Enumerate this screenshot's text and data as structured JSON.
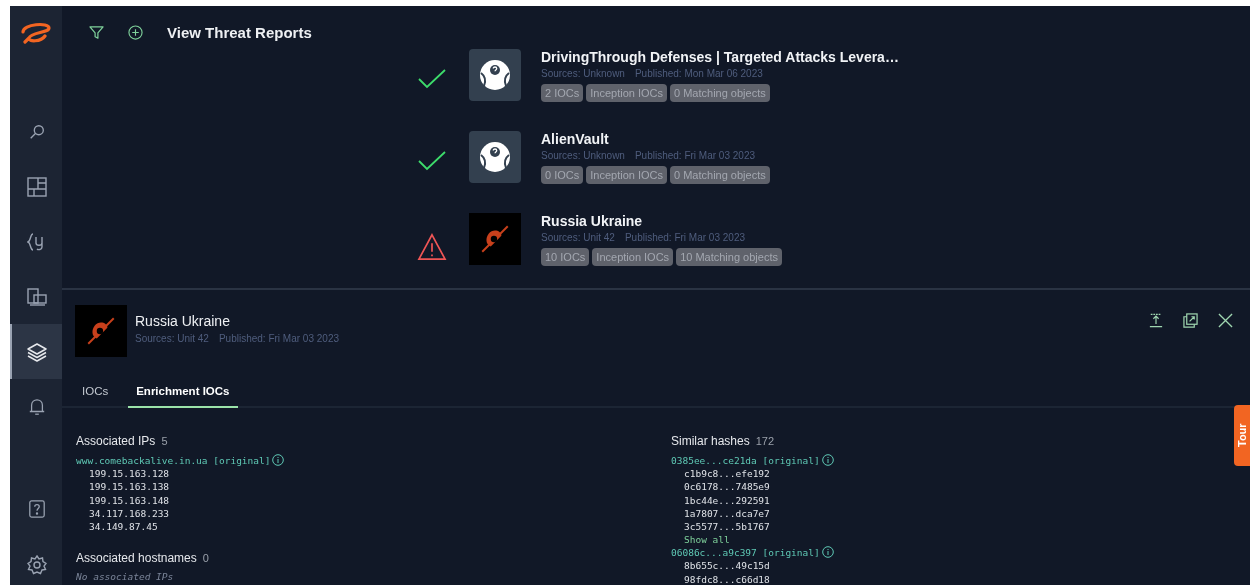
{
  "sidebar": {
    "items": [
      {
        "kind": "search",
        "selected": false
      },
      {
        "kind": "dashboard",
        "selected": false
      },
      {
        "kind": "code",
        "selected": false
      },
      {
        "kind": "monitor",
        "selected": false
      },
      {
        "kind": "layers",
        "selected": true
      },
      {
        "kind": "bell",
        "selected": false
      }
    ],
    "bottom": [
      {
        "kind": "help"
      },
      {
        "kind": "settings"
      }
    ]
  },
  "toolbar": {
    "title": "View Threat Reports"
  },
  "reports": [
    {
      "kind": "ok",
      "thumb": {
        "kind": "unknown"
      },
      "title": "DrivingThrough Defenses | Targeted Attacks Levera…",
      "sources": "Sources: Unknown",
      "published": "Published: Mon Mar 06 2023",
      "tags": [
        "2 IOCs",
        "Inception IOCs",
        "0 Matching objects"
      ]
    },
    {
      "kind": "ok",
      "thumb": {
        "kind": "unknown"
      },
      "title": "AlienVault",
      "sources": "Sources: Unknown",
      "published": "Published: Fri Mar 03 2023",
      "tags": [
        "0 IOCs",
        "Inception IOCs",
        "0 Matching objects"
      ]
    },
    {
      "kind": "warning",
      "thumb": {
        "kind": "comet"
      },
      "title": "Russia Ukraine",
      "sources": "Sources: Unit 42",
      "published": "Published: Fri Mar 03 2023",
      "tags": [
        "10 IOCs",
        "Inception IOCs",
        "10 Matching objects"
      ]
    }
  ],
  "detail": {
    "thumb": {
      "kind": "comet"
    },
    "title": "Russia Ukraine",
    "sources": "Sources: Unit 42",
    "published": "Published: Fri Mar 03 2023",
    "tabs": [
      {
        "label": "IOCs",
        "selected": false
      },
      {
        "label": "Enrichment IOCs",
        "selected": true
      }
    ],
    "columns": [
      [
        {
          "heading": "Associated IPs",
          "count": "5",
          "groups": [
            {
              "original": "www.comebackalive.in.ua [original]",
              "items": [
                "199.15.163.128",
                "199.15.163.138",
                "199.15.163.148",
                "34.117.168.233",
                "34.149.87.45"
              ]
            }
          ]
        },
        {
          "heading": "Associated hostnames",
          "count": "0",
          "empty": "No associated IPs"
        }
      ],
      [
        {
          "heading": "Similar hashes",
          "count": "172",
          "groups": [
            {
              "original": "0385ee...ce21da [original]",
              "items": [
                "c1b9c8...efe192",
                "0c6178...7485e9",
                "1bc44e...292591",
                "1a7807...dca7e7",
                "3c5577...5b1767"
              ],
              "show_all": "Show all"
            },
            {
              "original": "06086c...a9c397 [original]",
              "items": [
                "8b655c...49c15d",
                "98fdc8...c66d18"
              ]
            }
          ]
        }
      ]
    ]
  },
  "tour": "Tour"
}
